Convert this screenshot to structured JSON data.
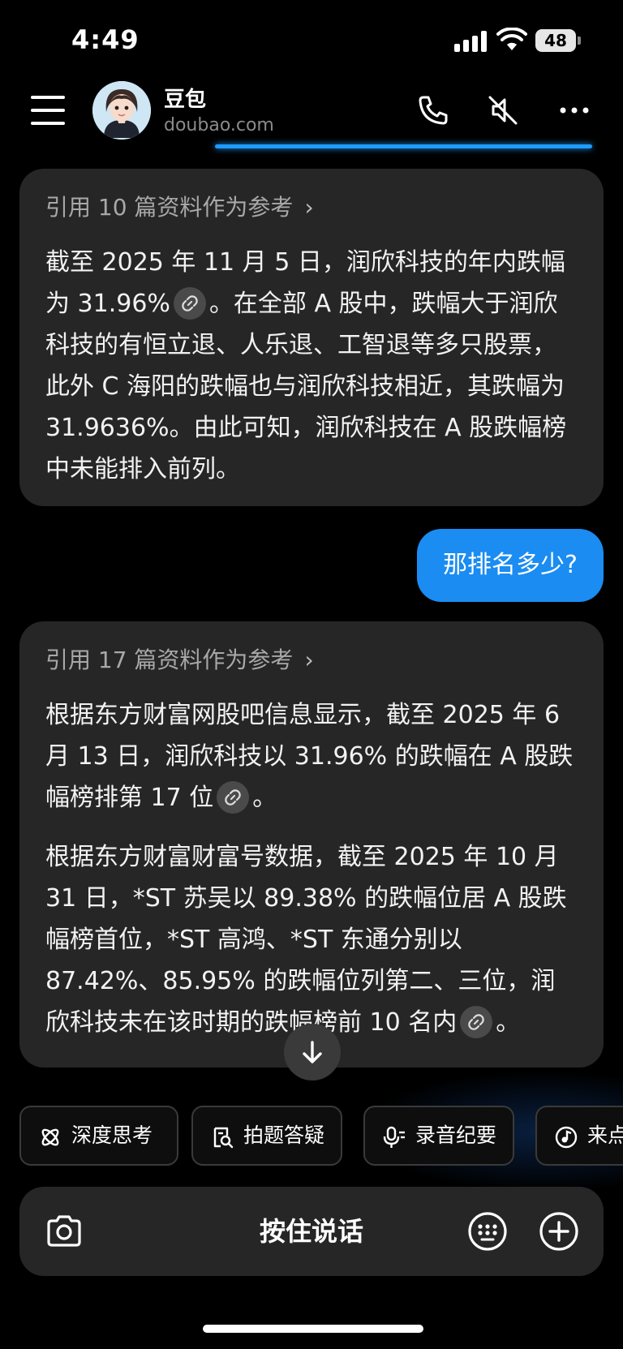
{
  "status_bar": {
    "time": "4:49",
    "battery": "48"
  },
  "header": {
    "name": "豆包",
    "domain": "doubao.com"
  },
  "messages": {
    "bot1": {
      "ref": "引用 10 篇资料作为参考",
      "p1_a": "截至 2025 年 11 月 5 日，润欣科技的年内跌幅为 31.96%",
      "p1_b": "。在全部 A 股中，跌幅大于润欣科技的有恒立退、人乐退、工智退等多只股票，此外 C 海阳的跌幅也与润欣科技相近，其跌幅为 31.9636%。由此可知，润欣科技在 A 股跌幅榜中未能排入前列。"
    },
    "user1": "那排名多少?",
    "bot2": {
      "ref": "引用 17 篇资料作为参考",
      "p1_a": "根据东方财富网股吧信息显示，截至 2025 年 6 月 13 日，润欣科技以 31.96% 的跌幅在 A 股跌幅榜排第 17 位",
      "p1_b": "。",
      "p2_a": "根据东方财富财富号数据，截至 2025 年 10 月 31 日，*ST 苏吴以 89.38% 的跌幅位居 A 股跌幅榜首位，*ST 高鸿、*ST 东通分别以 87.42%、85.95% 的跌幅位列第二、三位，润欣科技未在该时期的跌幅榜前 10 名内",
      "p2_b": "。"
    }
  },
  "quick_actions": [
    {
      "label": "深度思考",
      "icon": "atom-icon"
    },
    {
      "label": "拍题答疑",
      "icon": "document-search-icon"
    },
    {
      "label": "录音纪要",
      "icon": "microphone-icon"
    },
    {
      "label": "来点",
      "icon": "music-icon"
    }
  ],
  "input": {
    "hold_to_talk": "按住说话"
  },
  "colors": {
    "user_bubble": "#1a8cf2",
    "bot_bubble": "#262626",
    "accent_glow": "#1e9bff"
  }
}
